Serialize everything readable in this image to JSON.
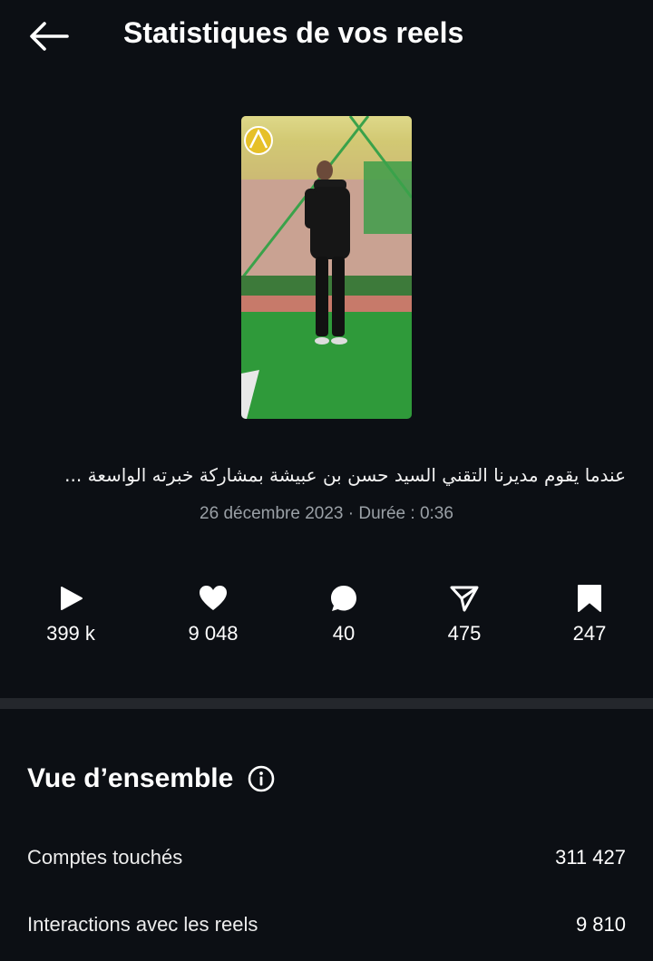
{
  "header": {
    "title": "Statistiques de vos reels",
    "back_icon": "arrow-left-icon"
  },
  "reel": {
    "caption": "عندما يقوم  مديرنا التقني السيد حسن بن عبيشة بمشاركة خبرته الواسعة ...",
    "meta": "26 décembre 2023 · Durée : 0:36"
  },
  "stats": [
    {
      "icon": "play-icon",
      "value": "399 k"
    },
    {
      "icon": "heart-icon",
      "value": "9 048"
    },
    {
      "icon": "comment-icon",
      "value": "40"
    },
    {
      "icon": "share-icon",
      "value": "475"
    },
    {
      "icon": "bookmark-icon",
      "value": "247"
    }
  ],
  "overview": {
    "title": "Vue d’ensemble",
    "info_icon": "info-icon",
    "rows": [
      {
        "label": "Comptes touchés",
        "value": "311 427"
      },
      {
        "label": "Interactions avec les reels",
        "value": "9 810"
      }
    ]
  },
  "colors": {
    "background": "#0c0f14",
    "divider": "#24272c",
    "muted_text": "#9aa0a6"
  }
}
